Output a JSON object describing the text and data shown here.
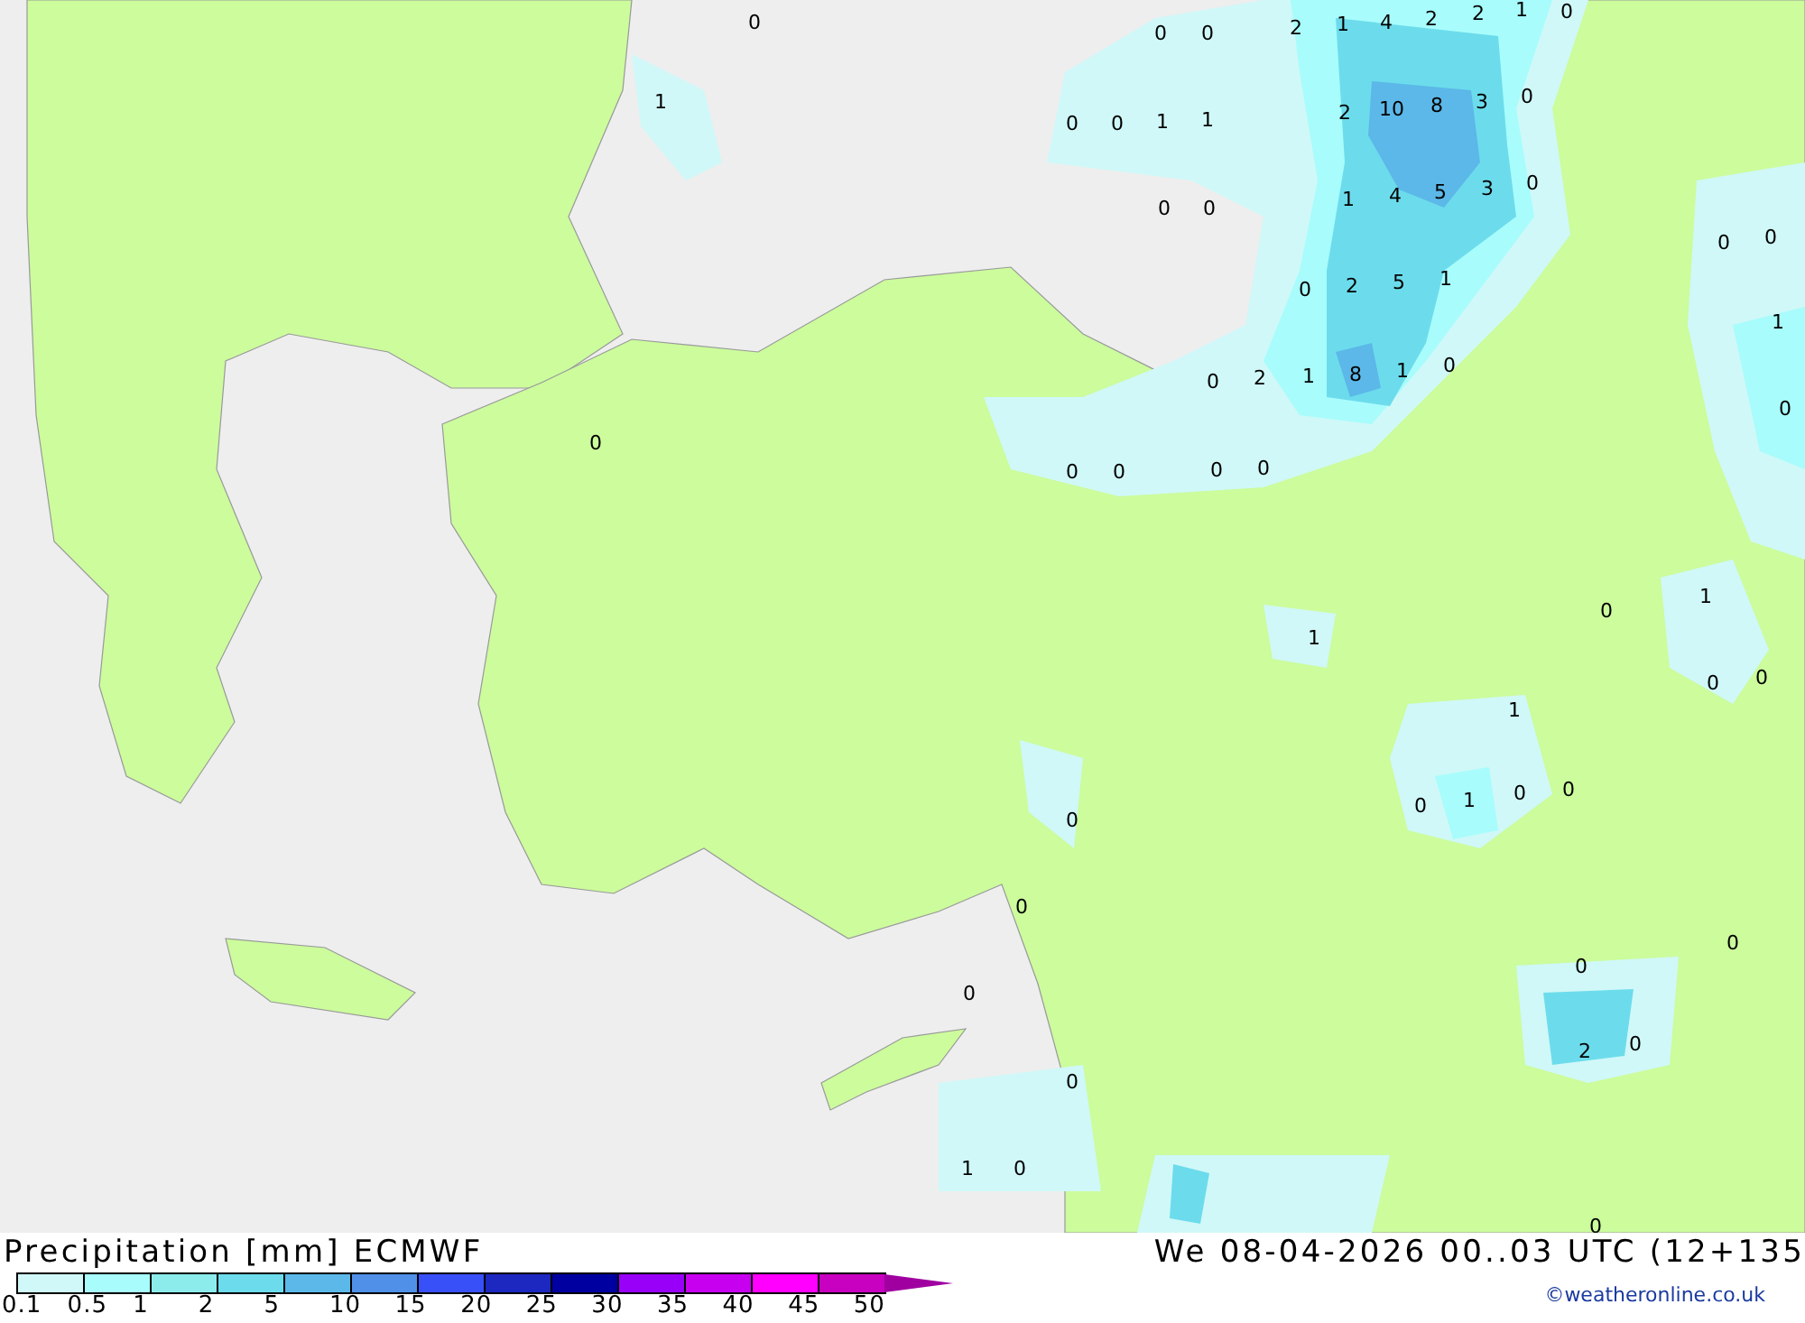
{
  "map": {
    "values": [
      "0",
      "1",
      "0",
      "0",
      "2",
      "1",
      "4",
      "2",
      "2",
      "1",
      "0",
      "0",
      "0",
      "1",
      "1",
      "2",
      "10",
      "8",
      "3",
      "0",
      "0",
      "0",
      "1",
      "4",
      "5",
      "3",
      "0",
      "0",
      "0",
      "0",
      "2",
      "5",
      "1",
      "1",
      "0",
      "2",
      "1",
      "8",
      "1",
      "0",
      "0",
      "0",
      "0",
      "0",
      "0",
      "0",
      "1",
      "0",
      "1",
      "0",
      "0",
      "1",
      "0",
      "1",
      "0",
      "0",
      "0",
      "0",
      "0",
      "0",
      "0",
      "2",
      "0",
      "0",
      "1",
      "0",
      "0"
    ]
  },
  "title": "Precipitation [mm] ECMWF",
  "valid_time": "We 08-04-2026 00..03 UTC (12+135",
  "legend": {
    "bins": [
      {
        "color": "#d0f8f8"
      },
      {
        "color": "#a8fcfc"
      },
      {
        "color": "#8cecec"
      },
      {
        "color": "#6cdcec"
      },
      {
        "color": "#5cb8e8"
      },
      {
        "color": "#5090e8"
      },
      {
        "color": "#3850f8"
      },
      {
        "color": "#1c28c0"
      },
      {
        "color": "#0000a0"
      },
      {
        "color": "#9800f8"
      },
      {
        "color": "#c800f0"
      },
      {
        "color": "#ff00ff"
      },
      {
        "color": "#c800c0"
      },
      {
        "color": "#a000a0",
        "kind": "arrow"
      }
    ],
    "ticks": [
      "0.1",
      "0.5",
      "1",
      "2",
      "5",
      "10",
      "15",
      "20",
      "25",
      "30",
      "35",
      "40",
      "45",
      "50"
    ]
  },
  "credit": "©weatheronline.co.uk"
}
